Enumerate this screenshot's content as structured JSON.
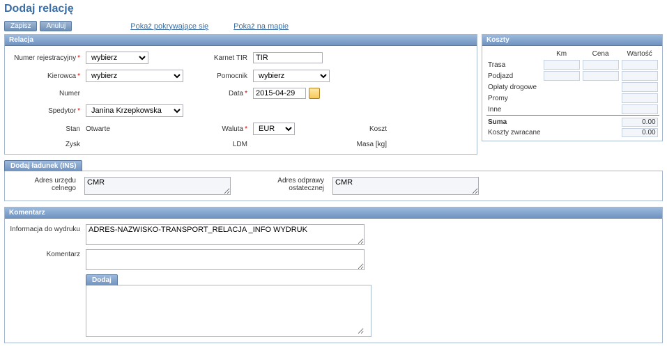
{
  "page": {
    "title": "Dodaj relację"
  },
  "toolbar": {
    "save": "Zapisz",
    "cancel": "Anuluj",
    "link_overlap": "Pokaż pokrywające się",
    "link_map": "Pokaż na mapie"
  },
  "relation": {
    "header": "Relacja",
    "labels": {
      "reg_no": "Numer rejestracyjny",
      "driver": "Kierowca",
      "number": "Numer",
      "spedytor": "Spedytor",
      "status": "Stan",
      "profit": "Zysk",
      "karnet": "Karnet TIR",
      "helper": "Pomocnik",
      "date": "Data",
      "currency": "Waluta",
      "ldm": "LDM",
      "koszt": "Koszt",
      "masa": "Masa [kg]"
    },
    "values": {
      "reg_no": "wybierz",
      "driver": "wybierz",
      "spedytor": "Janina Krzepkowska",
      "status": "Otwarte",
      "karnet": "TIR",
      "helper": "wybierz",
      "date": "2015-04-29",
      "currency": "EUR"
    }
  },
  "costs": {
    "header": "Koszty",
    "col_km": "Km",
    "col_price": "Cena",
    "col_value": "Wartość",
    "rows": {
      "trasa": "Trasa",
      "podjazd": "Podjazd",
      "oplaty": "Opłaty drogowe",
      "promy": "Promy",
      "inne": "Inne"
    },
    "sum_label": "Suma",
    "sum_value": "0.00",
    "returned_label": "Koszty zwracane",
    "returned_value": "0.00"
  },
  "cargo": {
    "header": "Dodaj ładunek (INS)"
  },
  "customs": {
    "label_office": "Adres urzędu celnego",
    "label_final": "Adres odprawy ostatecznej",
    "value_office": "CMR",
    "value_final": "CMR"
  },
  "comment": {
    "header": "Komentarz",
    "label_print": "Informacja do wydruku",
    "value_print": "ADRES-NAZWISKO-TRANSPORT_RELACJA _INFO WYDRUK",
    "label_comment": "Komentarz",
    "add_btn": "Dodaj"
  }
}
